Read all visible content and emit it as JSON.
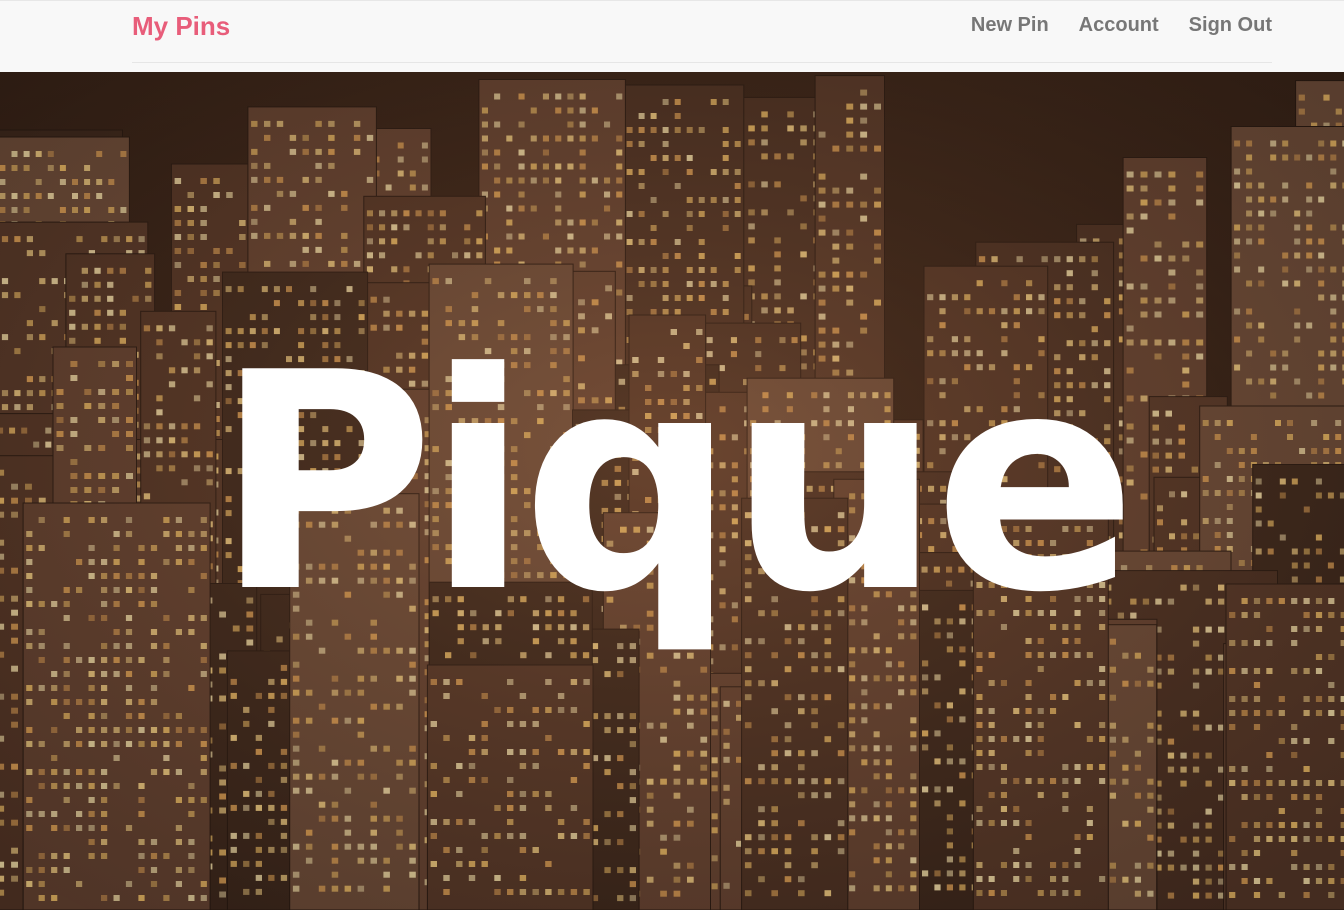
{
  "navbar": {
    "brand": "My Pins",
    "links": [
      {
        "label": "New Pin"
      },
      {
        "label": "Account"
      },
      {
        "label": "Sign Out"
      }
    ]
  },
  "hero": {
    "title": "Pique",
    "image_subject": "night city skyline with lit skyscraper windows"
  },
  "colors": {
    "brand": "#e85d7a",
    "nav_text": "#777777",
    "navbar_bg": "#f8f8f8",
    "hero_title": "#ffffff"
  }
}
